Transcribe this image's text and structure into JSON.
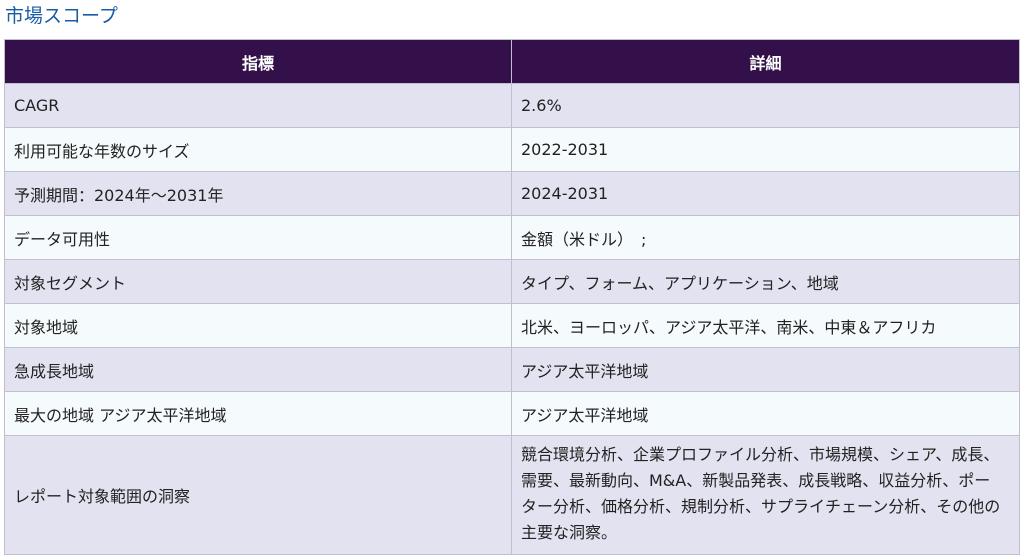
{
  "title": "市場スコープ",
  "table": {
    "headers": [
      "指標",
      "詳細"
    ],
    "rows": [
      {
        "metric": "CAGR",
        "detail": "2.6%"
      },
      {
        "metric": "利用可能な年数のサイズ",
        "detail": "2022-2031"
      },
      {
        "metric": "予測期間：2024年～2031年",
        "detail": "2024-2031"
      },
      {
        "metric": "データ可用性",
        "detail": "金額（米ドル）　;"
      },
      {
        "metric": "対象セグメント",
        "detail": "タイプ、フォーム、アプリケーション、地域"
      },
      {
        "metric": "対象地域",
        "detail": "北米、ヨーロッパ、アジア太平洋、南米、中東＆アフリカ"
      },
      {
        "metric": "急成長地域",
        "detail": "アジア太平洋地域"
      },
      {
        "metric": "最大の地域 アジア太平洋地域",
        "detail": "アジア太平洋地域"
      },
      {
        "metric": "レポート対象範囲の洞察",
        "detail": "競合環境分析、企業プロファイル分析、市場規模、シェア、成長、需要、最新動向、M&A、新製品発表、成長戦略、収益分析、ポーター分析、価格分析、規制分析、サプライチェーン分析、その他の主要な洞察。"
      }
    ]
  }
}
